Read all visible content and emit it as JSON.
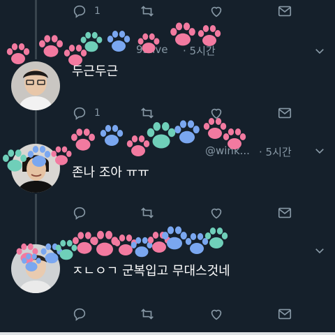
{
  "colors": {
    "background": "#15202b",
    "icon": "#8899a6",
    "divider": "#38444d",
    "paw_pink": "#f27aa0",
    "paw_blue": "#7aa7f0",
    "paw_teal": "#6fcfb9"
  },
  "tweets": [
    {
      "actions": {
        "reply_count": "1"
      }
    },
    {
      "name": "",
      "handle_suffix": "93live",
      "time": "· 5시간",
      "text": "두근두근",
      "avatar": "avatar-boy-glasses",
      "actions": {
        "reply_count": "1"
      }
    },
    {
      "name": "",
      "handle_suffix": "@wink...",
      "time": "· 5시간",
      "text": "존나 조아 ㅠㅠ",
      "avatar": "avatar-smiling-man",
      "actions": {
        "reply_count": ""
      }
    },
    {
      "name": "",
      "handle_suffix": "",
      "time": "",
      "text": "ㅈㄴㅇㄱ 군복입고 무대스것네",
      "avatar": "avatar-boy-portrait",
      "actions": {
        "reply_count": ""
      }
    }
  ],
  "icons": [
    "reply-icon",
    "retweet-icon",
    "like-icon",
    "message-icon",
    "chevron-down-icon"
  ]
}
